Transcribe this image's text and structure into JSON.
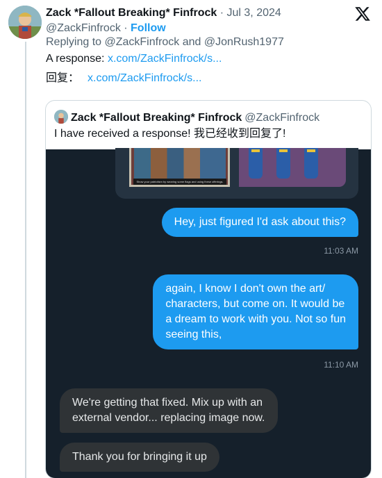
{
  "tweet": {
    "author_name": "Zack *Fallout Breaking* Finfrock",
    "separator": " · ",
    "date": "Jul 3, 2024",
    "handle": "@ZackFinfrock",
    "handle_separator": " · ",
    "follow_label": "Follow",
    "replying_to": "Replying to @ZackFinfrock and @JonRush1977",
    "line1_prefix": "A response: ",
    "line1_link": "x.com/ZackFinfrock/s...",
    "line2_prefix": "回复：",
    "line2_link": "x.com/ZackFinfrock/s..."
  },
  "quote": {
    "author_name": "Zack *Fallout Breaking* Finfrock",
    "handle": "@ZackFinfrock",
    "text": "I have received a response! 我已经收到回复了!"
  },
  "dm": {
    "image_caption": "Show your patriotism by wearing some flags and using these offerings.",
    "messages": [
      {
        "direction": "out",
        "lines": [
          "Hey, just figured I'd ask about this?"
        ],
        "time": "11:03 AM"
      },
      {
        "direction": "out",
        "lines": [
          "again, I know I don't own the art/",
          "characters, but come on. It would be",
          "a dream to work with you. Not so fun",
          "seeing this,"
        ],
        "time": "11:10 AM"
      },
      {
        "direction": "in",
        "lines": [
          "We're getting that fixed.  Mix up with an",
          "external vendor... replacing image now."
        ]
      },
      {
        "direction": "in",
        "lines": [
          "Thank you for bringing it up"
        ]
      }
    ]
  },
  "colors": {
    "link": "#1d9bf0",
    "dm_background": "#15202b",
    "outgoing_bubble": "#1d9bf0",
    "incoming_bubble": "#2f3336"
  },
  "icons": {
    "platform_logo": "x-logo-icon"
  }
}
